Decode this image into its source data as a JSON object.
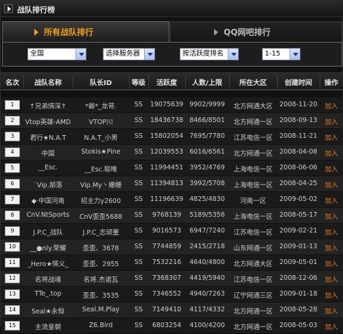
{
  "title": "战队排行榜",
  "tabs": {
    "all": "所有战队排行",
    "qq": "QQ网吧排行"
  },
  "filters": {
    "region": "全国",
    "server": "选择服务器",
    "sort": "按活跃度排名",
    "range": "1-15"
  },
  "columns": [
    "名次",
    "战队名称",
    "队长ID",
    "等级",
    "活跃度",
    "人数/上限",
    "所在大区",
    "创建时间",
    "操作"
  ],
  "rows": [
    {
      "rank": "1",
      "name": "↑兄弟情深↑",
      "leader": "*爺*_龙哥.",
      "level": "SS",
      "activity": "19075639",
      "members": "9902/9999",
      "zone": "北方网通大区",
      "created": "2008-11-20",
      "action": "加入"
    },
    {
      "rank": "2",
      "name": "Vtop英雄-AMD",
      "leader": "VTOP川",
      "level": "SS",
      "activity": "18436738",
      "members": "8466/8501",
      "zone": "北方网通一区",
      "created": "2008-09-13",
      "action": "加入"
    },
    {
      "rank": "3",
      "name": "君行★N.A.T",
      "leader": "N.A.T_小男",
      "level": "SS",
      "activity": "15802054",
      "members": "7695/7780",
      "zone": "江苏电信一区",
      "created": "2008-11-21",
      "action": "加入"
    },
    {
      "rank": "4",
      "name": "中国",
      "leader": "Stokis★Pine",
      "level": "SS",
      "activity": "12039553",
      "members": "6016/6561",
      "zone": "北方网通一区",
      "created": "2008-04-08",
      "action": "加入"
    },
    {
      "rank": "5",
      "name": "__Esc.",
      "leader": "__Esc.聪唯",
      "level": "SS",
      "activity": "11994451",
      "members": "3952/4769",
      "zone": "上海电信一区",
      "created": "2008-06-06",
      "action": "加入"
    },
    {
      "rank": "6",
      "name": "`Vip.部落",
      "leader": "Vip.My丶姗姗",
      "level": "SS",
      "activity": "11394813",
      "members": "3992/5708",
      "zone": "上海电信一区",
      "created": "2008-04-25",
      "action": "加入"
    },
    {
      "rank": "7",
      "name": "◆·中国河南",
      "leader": "招主力y2600",
      "level": "SS",
      "activity": "11196639",
      "members": "4825/4830",
      "zone": "河南一区",
      "created": "2009-05-02",
      "action": "加入"
    },
    {
      "rank": "8",
      "name": "CnV.NtSports",
      "leader": "CnV歪歪5688",
      "level": "SS",
      "activity": "9768139",
      "members": "5189/5356",
      "zone": "上海电信一区",
      "created": "2008-05-17",
      "action": "加入"
    },
    {
      "rank": "9",
      "name": "J.P.C_战队",
      "leader": "J.P.C_志顽童",
      "level": "SS",
      "activity": "9016573",
      "members": "6947/7240",
      "zone": "江苏电信一区",
      "created": "2009-02-21",
      "action": "加入"
    },
    {
      "rank": "10",
      "name": "__●nly.荣耀",
      "leader": "歪歪、3678",
      "level": "SS",
      "activity": "7744859",
      "members": "2415/2718",
      "zone": "山东网通一区",
      "created": "2009-01-13",
      "action": "加入"
    },
    {
      "rank": "11",
      "name": "_Hero★情义_",
      "leader": "歪歪、2955",
      "level": "SS",
      "activity": "7532216",
      "members": "4640/4800",
      "zone": "北方网通大区",
      "created": "2009-05-01",
      "action": "加入"
    },
    {
      "rank": "12",
      "name": "名将战魂",
      "leader": "名将.杰诺瓦",
      "level": "SS",
      "activity": "7368307",
      "members": "4419/5940",
      "zone": "江苏电信一区",
      "created": "2008-12-06",
      "action": "加入"
    },
    {
      "rank": "13",
      "name": "TTe_.top",
      "leader": "歪歪、3535",
      "level": "SS",
      "activity": "7346552",
      "members": "4940/7263",
      "zone": "辽宁网通三区",
      "created": "2009-01-18",
      "action": "加入"
    },
    {
      "rank": "14",
      "name": "Seal★永恒",
      "leader": "Seal.M.Play",
      "level": "SS",
      "activity": "7149410",
      "members": "4117/4332",
      "zone": "北方网通一区",
      "created": "2008-05-28",
      "action": "加入"
    },
    {
      "rank": "15",
      "name": "主流皇朝",
      "leader": "Z6.Bird",
      "level": "SS",
      "activity": "6803254",
      "members": "4100/4200",
      "zone": "北方网通一区",
      "created": "2008-05-03",
      "action": "加入"
    }
  ],
  "colors": {
    "accent": "#f0a010",
    "join": "#f07a10",
    "row_dark": "#1a1a1a",
    "row_light": "#232323"
  }
}
